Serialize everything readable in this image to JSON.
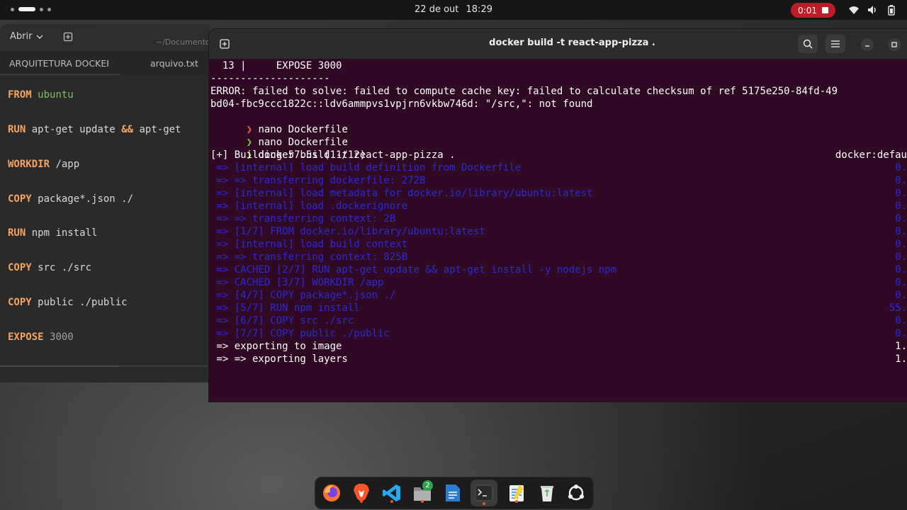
{
  "topbar": {
    "date": "22 de out",
    "time": "18:29",
    "recording_time": "0:01"
  },
  "editor": {
    "open_label": "Abrir",
    "path": "~/Documentos",
    "tabs": [
      {
        "label": "ARQUITETURA DOCKER"
      },
      {
        "label": "arquivo.txt"
      }
    ],
    "lines": [
      {
        "keyword": "FROM",
        "arg": "ubuntu"
      },
      {
        "keyword": "RUN",
        "arg": "apt-get update",
        "op": "&&",
        "rest": "apt-get"
      },
      {
        "keyword": "WORKDIR",
        "arg": "/app"
      },
      {
        "keyword": "COPY",
        "arg": "package*.json ./"
      },
      {
        "keyword": "RUN",
        "arg": "npm install"
      },
      {
        "keyword": "COPY",
        "arg": "src ./src"
      },
      {
        "keyword": "COPY",
        "arg": "public ./public"
      },
      {
        "keyword": "EXPOSE",
        "arg": "3000"
      }
    ]
  },
  "terminal": {
    "title": "docker build -t react-app-pizza .",
    "lines": [
      {
        "text": "  13 |     EXPOSE 3000"
      },
      {
        "text": "--------------------"
      },
      {
        "text": "ERROR: failed to solve: failed to compute cache key: failed to calculate checksum of ref 5175e250-84fd-49"
      },
      {
        "text": "bd04-fbc9ccc1822c::ldv6ammpvs1vpjrn6vkbw746d: \"/src,\": not found"
      },
      {
        "prompt": "❯",
        "text": " nano Dockerfile"
      },
      {
        "prompt": "❯",
        "text": " nano Dockerfile"
      },
      {
        "prompt": "❯",
        "text": " docker build -t react-app-pizza ."
      },
      {
        "text": "[+] Building 57.5s (11/12)",
        "right": "docker:defau"
      }
    ],
    "build_steps": [
      {
        "text": " => [internal] load build definition from Dockerfile",
        "right": "0."
      },
      {
        "text": " => => transferring dockerfile: 272B",
        "right": "0."
      },
      {
        "text": " => [internal] load metadata for docker.io/library/ubuntu:latest",
        "right": "0."
      },
      {
        "text": " => [internal] load .dockerignore",
        "right": "0."
      },
      {
        "text": " => => transferring context: 2B",
        "right": "0."
      },
      {
        "text": " => [1/7] FROM docker.io/library/ubuntu:latest",
        "right": "0."
      },
      {
        "text": " => [internal] load build context",
        "right": "0."
      },
      {
        "text": " => => transferring context: 825B",
        "right": "0."
      },
      {
        "text": " => CACHED [2/7] RUN apt-get update && apt-get install -y nodejs npm",
        "right": "0."
      },
      {
        "text": " => CACHED [3/7] WORKDIR /app",
        "right": "0."
      },
      {
        "text": " => [4/7] COPY package*.json ./",
        "right": "0."
      },
      {
        "text": " => [5/7] RUN npm install",
        "right": "55."
      },
      {
        "text": " => [6/7] COPY src ./src",
        "right": "0."
      },
      {
        "text": " => [7/7] COPY public ./public",
        "right": "0."
      }
    ],
    "export_lines": [
      {
        "text": " => exporting to image",
        "right": "1."
      },
      {
        "text": " => => exporting layers",
        "right": "1."
      }
    ]
  },
  "dock": {
    "files_badge": "2"
  }
}
